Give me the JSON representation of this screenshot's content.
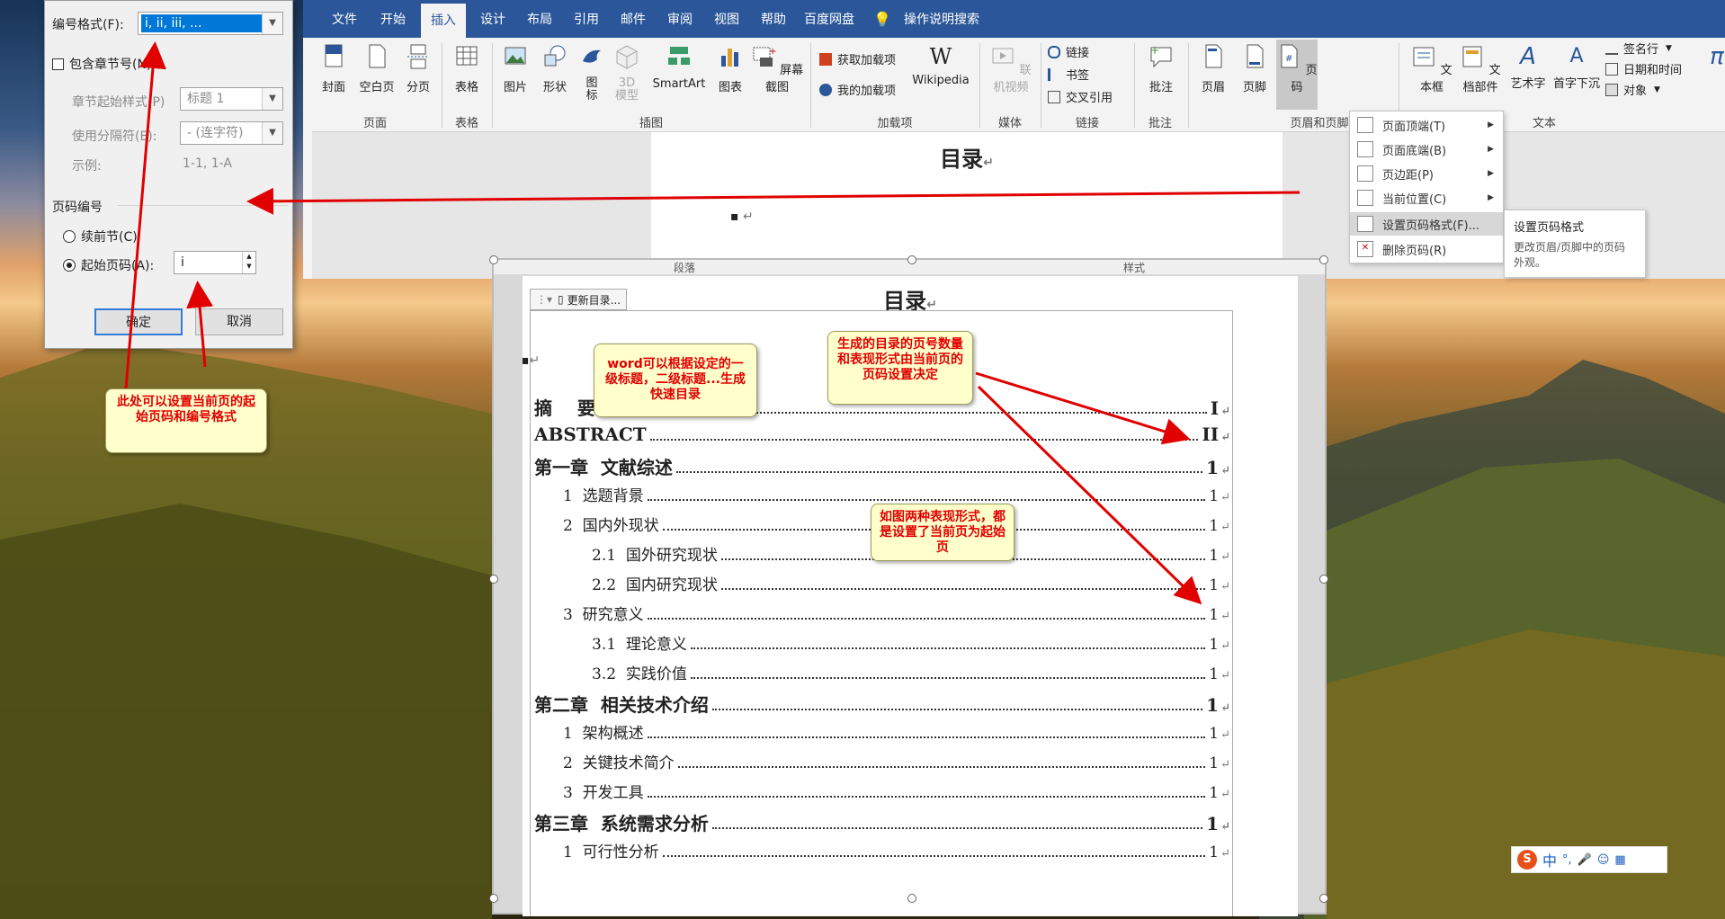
{
  "dialog": {
    "number_format_label": "编号格式(F):",
    "number_format_value": "i, ii, iii, ...",
    "include_chapter_label": "包含章节号(N)",
    "chapter_style_label": "章节起始样式(P)",
    "chapter_style_value": "标题 1",
    "separator_label": "使用分隔符(E):",
    "separator_value": "-  (连字符)",
    "example_label": "示例:",
    "example_value": "1-1, 1-A",
    "page_numbering_label": "页码编号",
    "continue_label": "续前节(C)",
    "start_at_label": "起始页码(A):",
    "start_at_value": "i",
    "ok_label": "确定",
    "cancel_label": "取消"
  },
  "ribbon": {
    "tabs": [
      "文件",
      "开始",
      "插入",
      "设计",
      "布局",
      "引用",
      "邮件",
      "审阅",
      "视图",
      "帮助",
      "百度网盘",
      "操作说明搜索"
    ],
    "active_tab": "插入",
    "buttons": {
      "cover": "封面",
      "blank": "空白页",
      "break": "分页",
      "table": "表格",
      "picture": "图片",
      "shapes": "形状",
      "icons": "图\n标",
      "model3d": "3D\n模型",
      "smartart": "SmartArt",
      "chart": "图表",
      "screenshot": "屏幕截图",
      "get_addins": "获取加载项",
      "my_addins": "我的加载项",
      "wikipedia": "Wikipedia",
      "online_video": "联机视频",
      "link": "链接",
      "bookmark": "书签",
      "crossref": "交叉引用",
      "comment": "批注",
      "header": "页眉",
      "footer": "页脚",
      "page_number": "页码",
      "textbox": "文本框",
      "quickparts": "文档部件",
      "wordart": "艺术字",
      "dropcap": "首字下沉",
      "signature": "签名行",
      "datetime": "日期和时间",
      "object": "对象"
    },
    "groups": {
      "pages": "页面",
      "tables": "表格",
      "illustrations": "插图",
      "addins": "加载项",
      "media": "媒体",
      "links": "链接",
      "comments": "批注",
      "header_footer": "页眉和页脚",
      "text": "文本"
    }
  },
  "doc_top": {
    "title": "目录",
    "bullet": "▪",
    "status_left": "段落",
    "status_right": "样式"
  },
  "menu": {
    "items": [
      "页面顶端(T)",
      "页面底端(B)",
      "页边距(P)",
      "当前位置(C)",
      "设置页码格式(F)...",
      "删除页码(R)"
    ],
    "tooltip_title": "设置页码格式",
    "tooltip_body": "更改页眉/页脚中的页码外观。"
  },
  "doc": {
    "title": "目录",
    "update_button": "更新目录...",
    "entries": [
      {
        "text": "摘    要",
        "page": "I",
        "level": 1
      },
      {
        "text": "ABSTRACT",
        "page": "II",
        "level": 1
      },
      {
        "text": "第一章  文献综述",
        "page": "1",
        "level": 1
      },
      {
        "text": "1  选题背景",
        "page": "1",
        "level": 2
      },
      {
        "text": "2  国内外现状",
        "page": "1",
        "level": 2
      },
      {
        "text": "2.1  国外研究现状",
        "page": "1",
        "level": 3
      },
      {
        "text": "2.2  国内研究现状",
        "page": "1",
        "level": 3
      },
      {
        "text": "3  研究意义",
        "page": "1",
        "level": 2
      },
      {
        "text": "3.1  理论意义",
        "page": "1",
        "level": 3
      },
      {
        "text": "3.2  实践价值",
        "page": "1",
        "level": 3
      },
      {
        "text": "第二章  相关技术介绍",
        "page": "1",
        "level": 1
      },
      {
        "text": "1  架构概述",
        "page": "1",
        "level": 2
      },
      {
        "text": "2  关键技术简介",
        "page": "1",
        "level": 2
      },
      {
        "text": "3  开发工具",
        "page": "1",
        "level": 2
      },
      {
        "text": "第三章  系统需求分析",
        "page": "1",
        "level": 1
      },
      {
        "text": "1  可行性分析",
        "page": "1",
        "level": 2
      }
    ]
  },
  "callouts": {
    "dialog_note": "此处可以设置当前页的起始页码和编号格式",
    "word_toc": "word可以根据设定的一级标题，二级标题...生成快速目录",
    "toc_pages": "生成的目录的页号数量和表现形式由当前页的页码设置决定",
    "two_forms": "如图两种表现形式，都是设置了当前页为起始页"
  },
  "ime": {
    "label": "中",
    "punct": "°,"
  },
  "colors": {
    "accent_blue": "#2b579a",
    "callout_text": "#e00000",
    "callout_bg": "#ffffcc",
    "arrow": "#e00000"
  }
}
